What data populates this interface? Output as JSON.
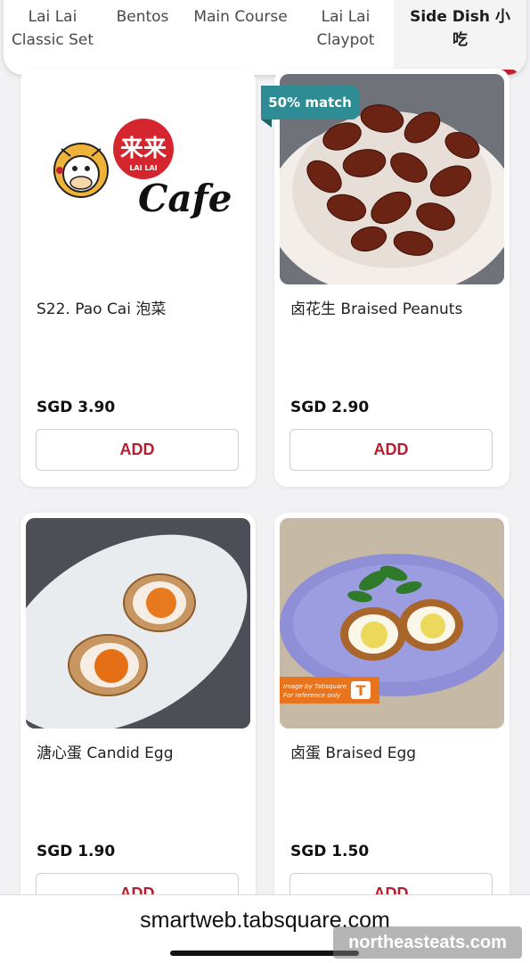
{
  "tabs": [
    {
      "label_line1": "Lai Lai",
      "label_line2": "Classic Set",
      "active": false
    },
    {
      "label_line1": "Bentos",
      "label_line2": "",
      "active": false
    },
    {
      "label_line1": "Main Course",
      "label_line2": "",
      "active": false
    },
    {
      "label_line1": "Lai Lai",
      "label_line2": "Claypot",
      "active": false
    },
    {
      "label_line1": "Side Dish 小",
      "label_line2": "吃",
      "active": true
    }
  ],
  "products": [
    {
      "name": "S22. Pao Cai 泡菜",
      "price": "SGD 3.90",
      "add_label": "ADD",
      "image": "lai-lai-cafe-logo"
    },
    {
      "name": "卤花生 Braised Peanuts",
      "price": "SGD 2.90",
      "add_label": "ADD",
      "image": "braised-peanuts-photo",
      "badge": "50% match"
    },
    {
      "name": "溏心蛋 Candid Egg",
      "price": "SGD 1.90",
      "add_label": "ADD",
      "image": "candid-egg-photo"
    },
    {
      "name": "卤蛋 Braised Egg",
      "price": "SGD 1.50",
      "add_label": "ADD",
      "image": "braised-egg-photo"
    }
  ],
  "logo": {
    "brand": "来来",
    "brand_latin": "LAI LAI",
    "word": "Cafe"
  },
  "image_overlay": {
    "line1": "Image by Tabsquare",
    "line2": "For reference only",
    "letter": "T"
  },
  "browser": {
    "url": "smartweb.tabsquare.com"
  },
  "watermark": "northeasteats.com",
  "colors": {
    "accent": "#b31f2e",
    "badge": "#2d8c94",
    "background": "#f2f2f4"
  }
}
